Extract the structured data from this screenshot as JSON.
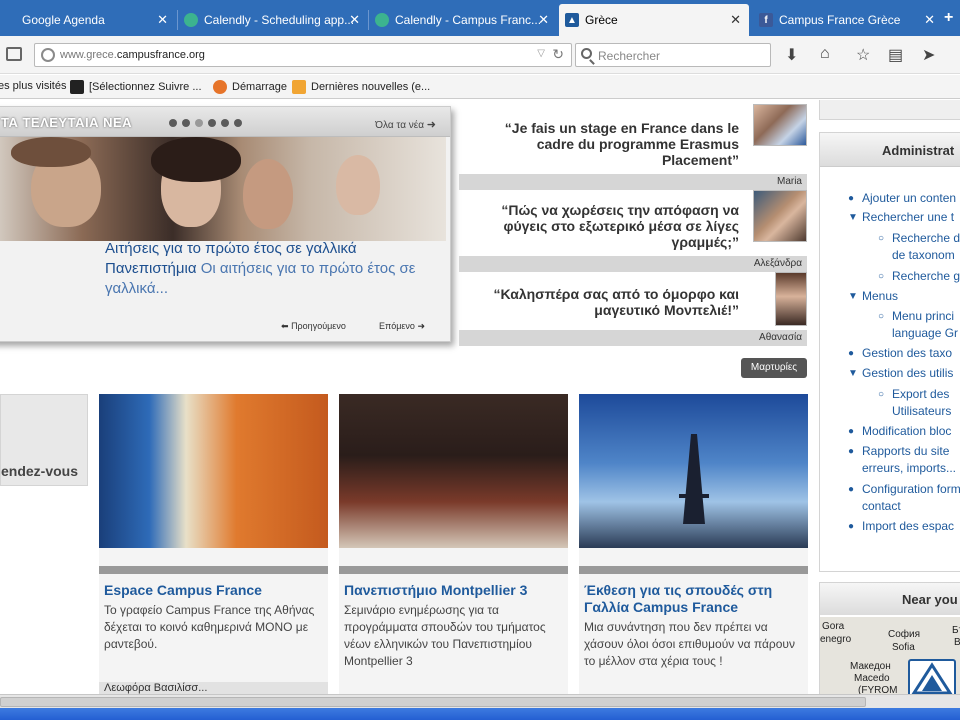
{
  "tabs": [
    {
      "label": "Google Agenda",
      "color": "#ffffff"
    },
    {
      "label": "Calendly - Scheduling app...",
      "color": "#3cb38f"
    },
    {
      "label": "Calendly - Campus Franc...",
      "color": "#3cb38f"
    },
    {
      "label": "Grèce",
      "color": "#1f5a9c"
    },
    {
      "label": "Campus France Grèce",
      "color": "#3b5998"
    }
  ],
  "nav": {
    "url_prefix": "www.grece.",
    "url_domain": "campusfrance.org",
    "search_placeholder": "Rechercher"
  },
  "bookmarks": [
    "es plus visités",
    "[Sélectionnez Suivre ...",
    "Démarrage",
    "Dernières nouvelles (e..."
  ],
  "news": {
    "title": "ΤΑ ΤΕΛΕΥΤΑΙΑ ΝΕΑ",
    "all_link": "Όλα τα νέα",
    "headline": "Αιτήσεις για το πρώτο έτος σε γαλλικά Πανεπιστήμια",
    "summary": " Οι αιτήσεις για το πρώτο έτος σε γαλλικά...",
    "prev": "Προηγούμενο",
    "next": "Επόμενο"
  },
  "testimonials": [
    {
      "quote": "“Je fais un stage en France dans le cadre du programme Erasmus Placement”",
      "author": "Maria"
    },
    {
      "quote": "“Πώς να χωρέσεις την απόφαση να φύγεις στο εξωτερικό μέσα σε λίγες γραμμές;”",
      "author": "Αλεξάνδρα"
    },
    {
      "quote": "“Καλησπέρα σας από το όμορφο και μαγευτικό Μονπελιέ!”",
      "author": "Αθανασία"
    }
  ],
  "testimonials_button": "Μαρτυρίες",
  "rdv_label": "endez-vous",
  "cards": [
    {
      "title": "Espace Campus France",
      "desc": "Το γραφείο Campus France της Αθήνας δέχεται το κοινό καθημερινά ΜΟΝΟ με ραντεβού.",
      "more": "Λεωφόρα Βασιλίσσ..."
    },
    {
      "title": "Πανεπιστήμιο Montpellier 3",
      "desc": "Σεμινάριο ενημέρωσης για τα προγράμματα σπουδών του τμήματος νέων ελληνικών του Πανεπιστημίου Montpellier 3"
    },
    {
      "title": "Έκθεση για τις σπουδές στη Γαλλία Campus France",
      "desc": "Μια συνάντηση που δεν πρέπει να χάσουν όλοι όσοι επιθυμούν να πάρουν το μέλλον στα χέρια τους !"
    }
  ],
  "admin": {
    "title": "Administrat",
    "items": [
      "Ajouter un conten",
      "Rechercher une t",
      "Recherche d",
      "de taxonom",
      "Recherche g",
      "Menus",
      "Menu princi",
      "language Gr",
      "Gestion des taxo",
      "Gestion des utilis",
      "Export des",
      "Utilisateurs",
      "Modification bloc",
      "Rapports du site",
      "erreurs, imports...",
      "Configuration form",
      "contact",
      "Import des espac"
    ]
  },
  "near": {
    "title": "Near you",
    "map_labels": [
      "Gora",
      "enegro",
      "София",
      "Sofia",
      "Бъ",
      "Bu",
      "Македон",
      "Macedo",
      "(FYROM"
    ]
  }
}
